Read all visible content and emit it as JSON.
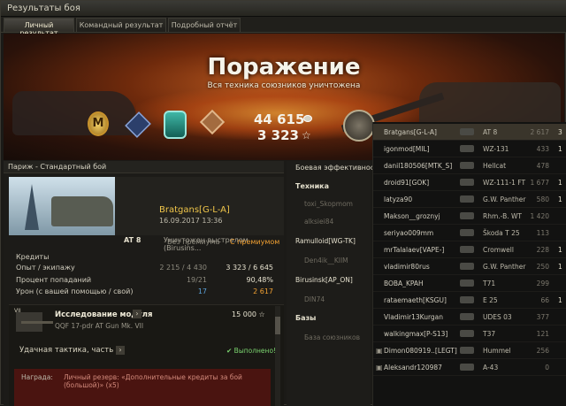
{
  "window": {
    "title": "Результаты боя"
  },
  "tabs": [
    "Личный результат",
    "Командный результат",
    "Подробный отчёт"
  ],
  "banner": {
    "result": "Поражение",
    "subtitle": "Вся техника союзников уничтожена",
    "credits": "44 615",
    "xp": "3 323",
    "medal_letter": "М",
    "icons": [
      "coin-icon",
      "star-icon",
      "mastery-badge-icon",
      "rank-badge-icon",
      "chip-badge-icon",
      "trophy-icon"
    ]
  },
  "left": {
    "header": "Париж - Стандартный бой",
    "player": "Bratgans[G-L-A]",
    "datetime": "16.09.2017 13:36",
    "tier": "AT 8",
    "destroyed_by": "Уничтожен выстрелом (Birusins...",
    "col_no_premium": "Без премиума",
    "col_premium": "С премиумом",
    "stats": [
      {
        "label": "Кредиты",
        "v1": "",
        "v2": ""
      },
      {
        "label": "Опыт / экипажу",
        "v1": "2 215 / 4 430",
        "v2": "3 323 / 6 645"
      },
      {
        "label": "Процент попаданий",
        "v1": "19/21",
        "v2": "90,48%"
      },
      {
        "label": "Урон (с вашей помощью / свой)",
        "v1": "17",
        "v2": "2 617"
      }
    ],
    "task": {
      "tier": "VII",
      "title": "Исследование модуля",
      "module": "QQF 17-pdr AT Gun Mk. VII",
      "cost": "15 000",
      "lucky": "Удачная тактика, часть 3",
      "done": "Выполнено!",
      "reward_label": "Награда:",
      "reward_text": "Личный резерв: «Дополнительные кредиты за бой (большой)» (x5)"
    }
  },
  "middle": {
    "header": "Боевая эффективность",
    "technique": "Техника",
    "rows": [
      "toxi_Skopmom",
      "alksiei84",
      "Ramulloid[WG-TK]",
      "Den4ik__KIIM",
      "Birusinsk[AP_ON]",
      "DIN74"
    ],
    "bases": "Базы",
    "bases_row": "База союзников"
  },
  "right": {
    "rows": [
      {
        "name": "Bratgans[G-L-A]",
        "tank": "AT 8",
        "dmg": "2 617",
        "frags": "3",
        "me": true
      },
      {
        "name": "igonmod[MIL]",
        "tank": "WZ-131",
        "dmg": "433",
        "frags": "1"
      },
      {
        "name": "danil180506[MTK_S]",
        "tank": "Hellcat",
        "dmg": "478",
        "frags": ""
      },
      {
        "name": "droid91[GOK]",
        "tank": "WZ-111-1 FT",
        "dmg": "1 677",
        "frags": "1"
      },
      {
        "name": "latyza90",
        "tank": "G.W. Panther",
        "dmg": "580",
        "frags": "1"
      },
      {
        "name": "Makson__groznyj",
        "tank": "Rhm.-B. WT",
        "dmg": "1 420",
        "frags": ""
      },
      {
        "name": "seriyao009mm",
        "tank": "Škoda T 25",
        "dmg": "113",
        "frags": ""
      },
      {
        "name": "mrTalalaev[VAPE-]",
        "tank": "Cromwell",
        "dmg": "228",
        "frags": "1"
      },
      {
        "name": "vladimir80rus",
        "tank": "G.W. Panther",
        "dmg": "250",
        "frags": "1"
      },
      {
        "name": "BOBA_KPAH",
        "tank": "T71",
        "dmg": "299",
        "frags": ""
      },
      {
        "name": "rataemaeth[KSGU]",
        "tank": "E 25",
        "dmg": "66",
        "frags": "1"
      },
      {
        "name": "Vladimir13Kurgan",
        "tank": "UDES 03",
        "dmg": "377",
        "frags": ""
      },
      {
        "name": "walkingmax[P-S13]",
        "tank": "T37",
        "dmg": "121",
        "frags": ""
      },
      {
        "name": "Dimon080919..[LEGT]",
        "tank": "Hummel",
        "dmg": "256",
        "frags": ""
      },
      {
        "name": "Aleksandr120987",
        "tank": "A-43",
        "dmg": "0",
        "frags": ""
      }
    ]
  }
}
